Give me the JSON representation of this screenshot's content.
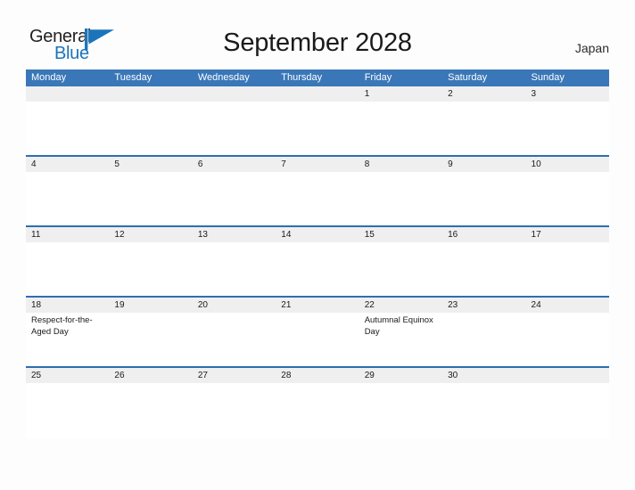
{
  "brand": {
    "name_part1": "General",
    "name_part2": "Blue",
    "flag_icon": "blue-triangle-flag-icon",
    "color_dark": "#231f20",
    "color_blue": "#1b74bb"
  },
  "header": {
    "title": "September 2028",
    "region": "Japan"
  },
  "colors": {
    "header_blue": "#3a77b8",
    "separator_blue": "#2d6fb0",
    "day_band_gray": "#efefef",
    "page_background": "#fdfdfd"
  },
  "calendar": {
    "month": "September",
    "year": "2028",
    "weekdays": [
      "Monday",
      "Tuesday",
      "Wednesday",
      "Thursday",
      "Friday",
      "Saturday",
      "Sunday"
    ],
    "weeks": [
      {
        "days": [
          {
            "number": "",
            "events": []
          },
          {
            "number": "",
            "events": []
          },
          {
            "number": "",
            "events": []
          },
          {
            "number": "",
            "events": []
          },
          {
            "number": "1",
            "events": []
          },
          {
            "number": "2",
            "events": []
          },
          {
            "number": "3",
            "events": []
          }
        ]
      },
      {
        "days": [
          {
            "number": "4",
            "events": []
          },
          {
            "number": "5",
            "events": []
          },
          {
            "number": "6",
            "events": []
          },
          {
            "number": "7",
            "events": []
          },
          {
            "number": "8",
            "events": []
          },
          {
            "number": "9",
            "events": []
          },
          {
            "number": "10",
            "events": []
          }
        ]
      },
      {
        "days": [
          {
            "number": "11",
            "events": []
          },
          {
            "number": "12",
            "events": []
          },
          {
            "number": "13",
            "events": []
          },
          {
            "number": "14",
            "events": []
          },
          {
            "number": "15",
            "events": []
          },
          {
            "number": "16",
            "events": []
          },
          {
            "number": "17",
            "events": []
          }
        ]
      },
      {
        "days": [
          {
            "number": "18",
            "events": [
              "Respect-for-the-Aged Day"
            ]
          },
          {
            "number": "19",
            "events": []
          },
          {
            "number": "20",
            "events": []
          },
          {
            "number": "21",
            "events": []
          },
          {
            "number": "22",
            "events": [
              "Autumnal Equinox Day"
            ]
          },
          {
            "number": "23",
            "events": []
          },
          {
            "number": "24",
            "events": []
          }
        ]
      },
      {
        "days": [
          {
            "number": "25",
            "events": []
          },
          {
            "number": "26",
            "events": []
          },
          {
            "number": "27",
            "events": []
          },
          {
            "number": "28",
            "events": []
          },
          {
            "number": "29",
            "events": []
          },
          {
            "number": "30",
            "events": []
          },
          {
            "number": "",
            "events": []
          }
        ]
      }
    ]
  }
}
